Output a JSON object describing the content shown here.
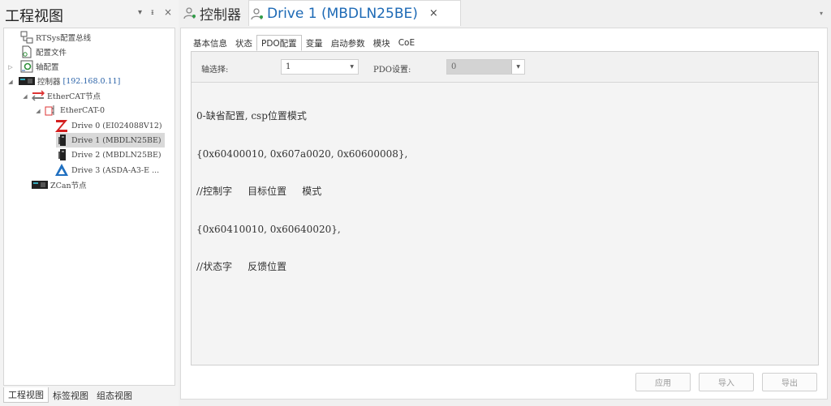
{
  "left_panel": {
    "title": "工程视图",
    "header_buttons": {
      "dropdown": "▾",
      "pin": "ᵻ",
      "close": "×"
    },
    "tree": [
      {
        "label": "RTSys配置总线",
        "icon": "network-config-icon"
      },
      {
        "label": "配置文件",
        "icon": "config-file-icon"
      },
      {
        "label": "轴配置",
        "icon": "axis-config-icon",
        "expander": "collapsed"
      },
      {
        "label": "控制器",
        "ip": "[192.168.0.11]",
        "icon": "controller-icon",
        "expander": "expanded"
      },
      {
        "label": "EtherCAT节点",
        "icon": "ethercat-node-icon",
        "expander": "expanded"
      },
      {
        "label": "EtherCAT-0",
        "icon": "ethercat-bus-icon",
        "expander": "expanded"
      },
      {
        "label": "Drive 0 (EI024088V12)",
        "icon": "z-drive-icon"
      },
      {
        "label": "Drive 1 (MBDLN25BE)",
        "icon": "servo-drive-icon",
        "selected": true
      },
      {
        "label": "Drive 2 (MBDLN25BE)",
        "icon": "servo-drive-icon"
      },
      {
        "label": "Drive 3 (ASDA-A3-E ...",
        "icon": "triangle-drive-icon"
      },
      {
        "label": "ZCan节点",
        "icon": "zcan-node-icon"
      }
    ],
    "bottom_tabs": [
      "工程视图",
      "标签视图",
      "组态视图"
    ]
  },
  "doc_tabs": {
    "controller": "控制器",
    "drive": "Drive 1 (MBDLN25BE)",
    "close": "×",
    "menu": "▾"
  },
  "sub_tabs": [
    "基本信息",
    "状态",
    "PDO配置",
    "变量",
    "启动参数",
    "模块",
    "CoE"
  ],
  "active_sub_tab": "PDO配置",
  "pdo": {
    "axis_label": "轴选择:",
    "axis_value": "1",
    "setting_label": "PDO设置:",
    "setting_value": "0",
    "code_lines": [
      "0-缺省配置, csp位置模式",
      "{0x60400010, 0x607a0020, 0x60600008},",
      "//控制字     目标位置     模式",
      "{0x60410010, 0x60640020},",
      "//状态字     反馈位置"
    ]
  },
  "buttons": {
    "apply": "应用",
    "import": "导入",
    "export": "导出"
  },
  "colors": {
    "accent": "#1c69b5",
    "ip": "#2a62a8",
    "selected_row": "#d9d9d9"
  }
}
